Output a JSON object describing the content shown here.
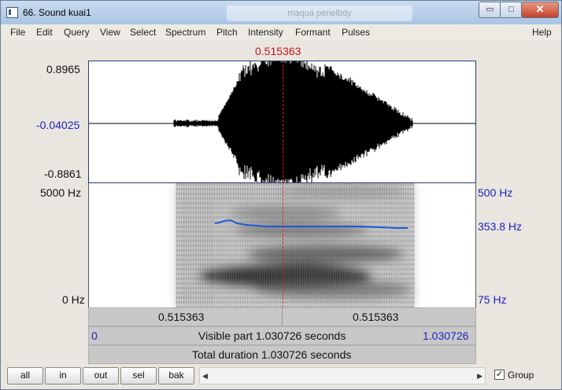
{
  "window": {
    "title": "66. Sound kuai1",
    "background_tab_text": "maqua penelbdy",
    "controls": {
      "minimize": "minimize-icon",
      "maximize": "maximize-icon",
      "close": "close-icon"
    }
  },
  "menu": [
    "File",
    "Edit",
    "Query",
    "View",
    "Select",
    "Spectrum",
    "Pitch",
    "Intensity",
    "Formant",
    "Pulses",
    "Help"
  ],
  "cursor_time": "0.515363",
  "waveform": {
    "y_max": "0.8965",
    "y_zero": "-0.04025",
    "y_min": "-0.8861"
  },
  "spectrogram": {
    "freq_top": "5000 Hz",
    "freq_bottom": "0 Hz",
    "pitch_top": "500 Hz",
    "pitch_value": "353.8 Hz",
    "pitch_bottom": "75 Hz"
  },
  "time_bar": {
    "left": "0.515363",
    "right": "0.515363"
  },
  "visible_bar": {
    "start": "0",
    "text": "Visible part 1.030726 seconds",
    "end": "1.030726"
  },
  "total_bar": {
    "text": "Total duration 1.030726 seconds"
  },
  "buttons": {
    "all": "all",
    "in": "in",
    "out": "out",
    "sel": "sel",
    "bak": "bak"
  },
  "group": {
    "label": "Group",
    "checked": true,
    "check_glyph": "✓"
  },
  "colors": {
    "pitch_line": "#1a5ad8",
    "cursor": "#e02020",
    "axis_blue": "#2020c0"
  }
}
